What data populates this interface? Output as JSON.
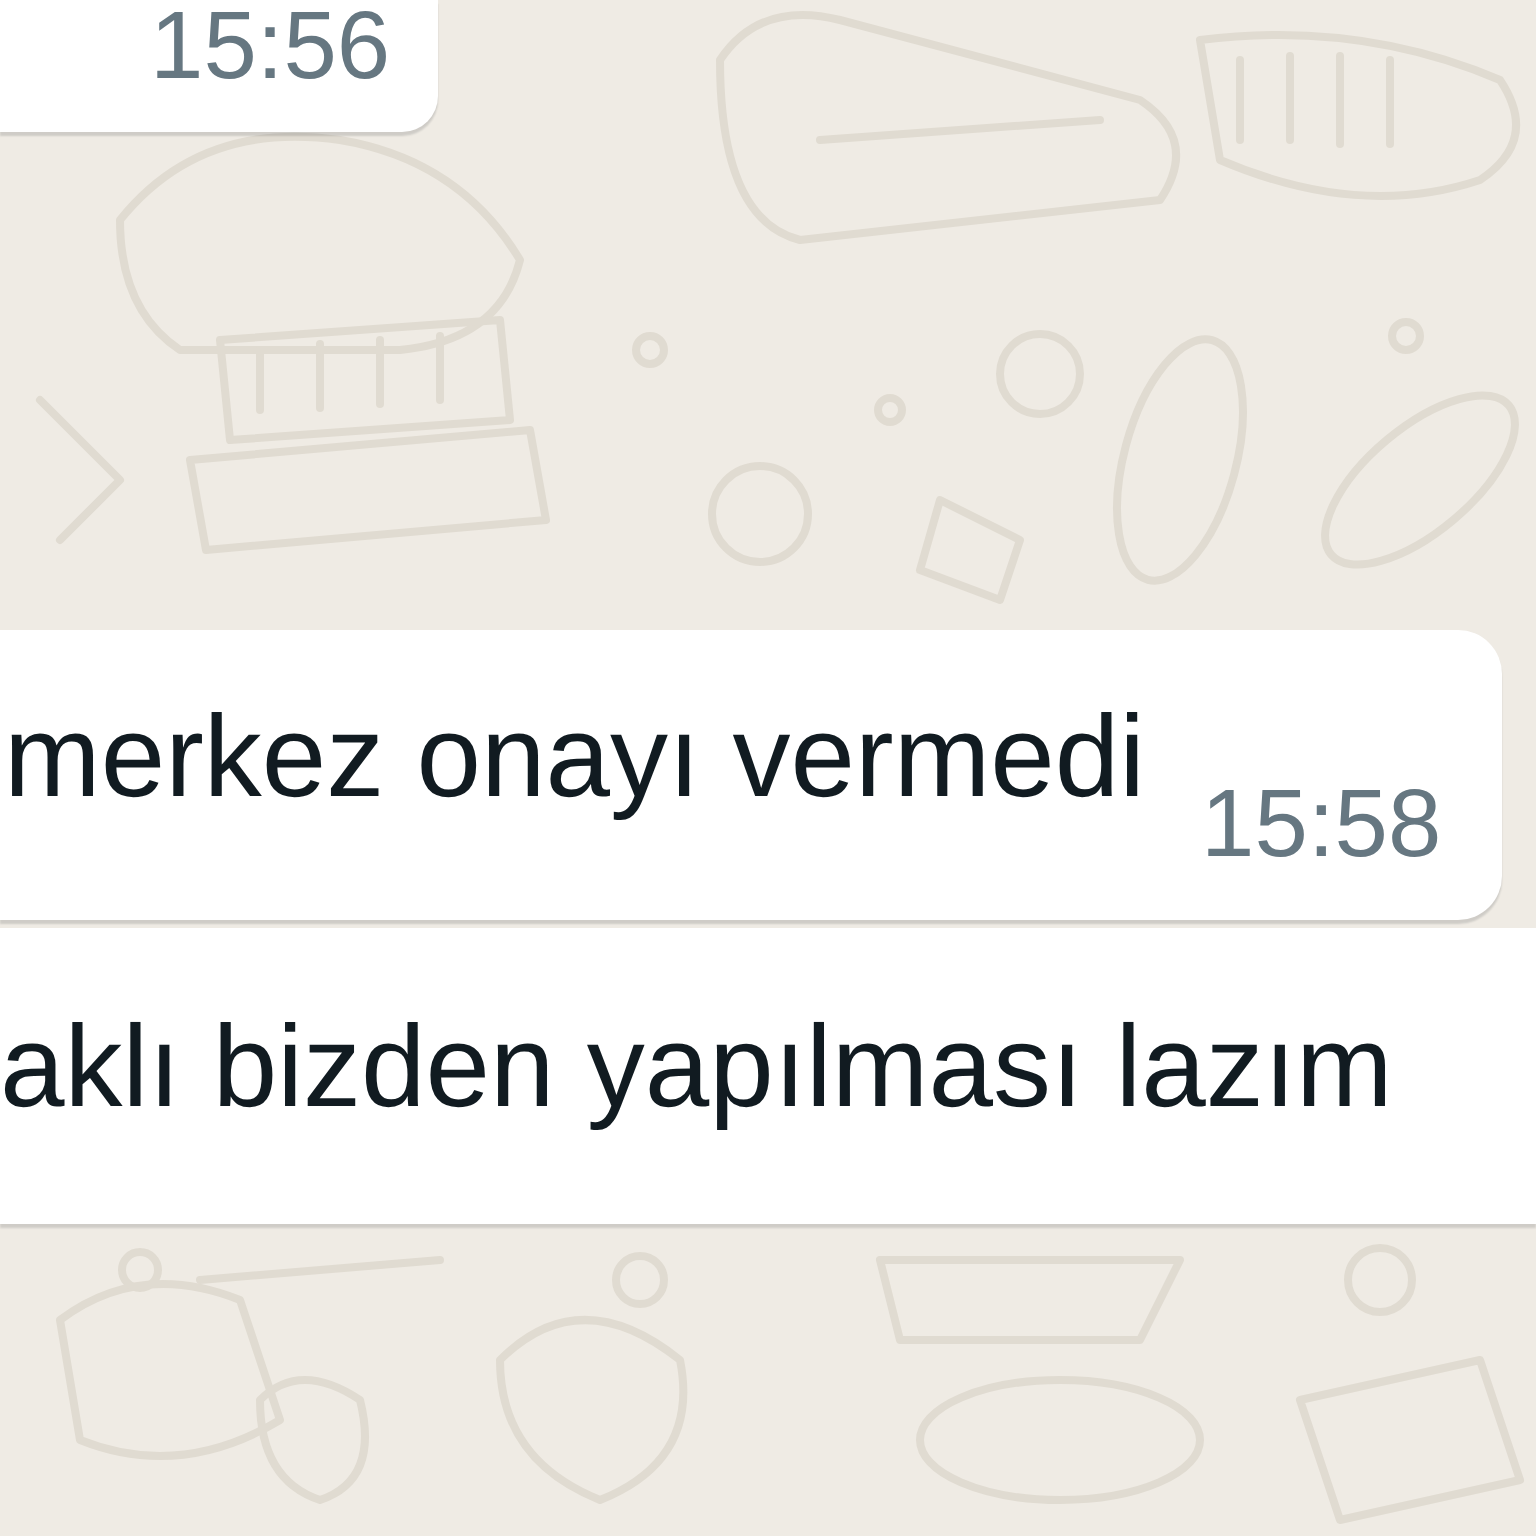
{
  "messages": [
    {
      "time": "15:56"
    },
    {
      "text": "merkez onayı vermedi",
      "time": "15:58"
    },
    {
      "text": "aklı bizden yapılması lazım"
    }
  ]
}
